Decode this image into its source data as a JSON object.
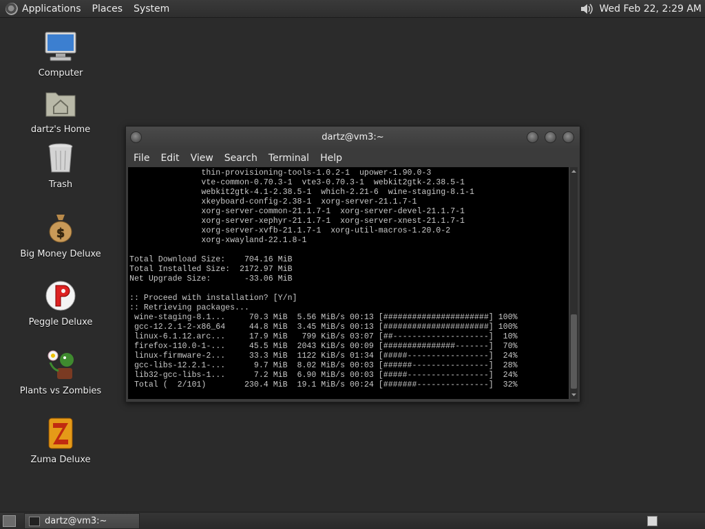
{
  "top_panel": {
    "menus": [
      "Applications",
      "Places",
      "System"
    ],
    "clock": "Wed Feb 22,  2:29 AM",
    "volume_icon": "speaker-icon"
  },
  "desktop_icons": [
    {
      "label": "Computer",
      "icon": "computer-icon"
    },
    {
      "label": "dartz's Home",
      "icon": "home-folder-icon"
    },
    {
      "label": "Trash",
      "icon": "trash-icon"
    },
    {
      "label": "Big Money Deluxe",
      "icon": "money-bag-icon"
    },
    {
      "label": "Peggle Deluxe",
      "icon": "peggle-icon"
    },
    {
      "label": "Plants vs Zombies",
      "icon": "plants-vs-zombies-icon"
    },
    {
      "label": "Zuma Deluxe",
      "icon": "zuma-icon"
    }
  ],
  "window": {
    "title": "dartz@vm3:~",
    "menus": [
      "File",
      "Edit",
      "View",
      "Search",
      "Terminal",
      "Help"
    ]
  },
  "terminal": {
    "lines": [
      "               thin-provisioning-tools-1.0.2-1  upower-1.90.0-3",
      "               vte-common-0.70.3-1  vte3-0.70.3-1  webkit2gtk-2.38.5-1",
      "               webkit2gtk-4.1-2.38.5-1  which-2.21-6  wine-staging-8.1-1",
      "               xkeyboard-config-2.38-1  xorg-server-21.1.7-1",
      "               xorg-server-common-21.1.7-1  xorg-server-devel-21.1.7-1",
      "               xorg-server-xephyr-21.1.7-1  xorg-server-xnest-21.1.7-1",
      "               xorg-server-xvfb-21.1.7-1  xorg-util-macros-1.20.0-2",
      "               xorg-xwayland-22.1.8-1",
      "",
      "Total Download Size:    704.16 MiB",
      "Total Installed Size:  2172.97 MiB",
      "Net Upgrade Size:       -33.06 MiB",
      "",
      ":: Proceed with installation? [Y/n]",
      ":: Retrieving packages...",
      " wine-staging-8.1...     70.3 MiB  5.56 MiB/s 00:13 [######################] 100%",
      " gcc-12.2.1-2-x86_64     44.8 MiB  3.45 MiB/s 00:13 [######################] 100%",
      " linux-6.1.12.arc...     17.9 MiB   799 KiB/s 03:07 [##--------------------]  10%",
      " firefox-110.0-1-...     45.5 MiB  2043 KiB/s 00:09 [###############-------]  70%",
      " linux-firmware-2...     33.3 MiB  1122 KiB/s 01:34 [#####-----------------]  24%",
      " gcc-libs-12.2.1-...      9.7 MiB  8.02 MiB/s 00:03 [######----------------]  28%",
      " lib32-gcc-libs-1...      7.2 MiB  6.90 MiB/s 00:03 [#####-----------------]  24%",
      " Total (  2/101)        230.4 MiB  19.1 MiB/s 00:24 [#######---------------]  32%"
    ]
  },
  "taskbar": {
    "task_label": "dartz@vm3:~"
  }
}
